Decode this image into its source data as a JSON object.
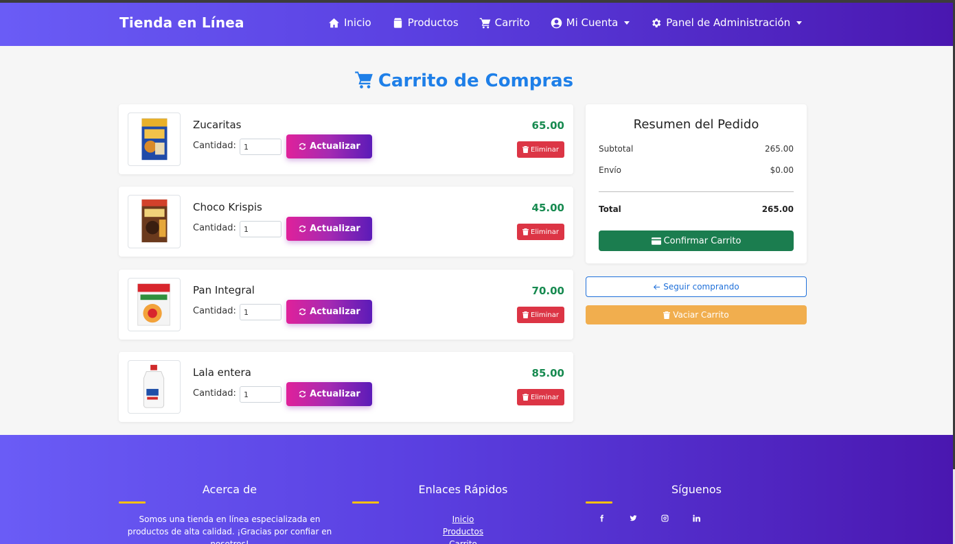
{
  "navbar": {
    "brand": "Tienda en Línea",
    "items": [
      {
        "label": "Inicio",
        "icon": "home-icon"
      },
      {
        "label": "Productos",
        "icon": "box-icon"
      },
      {
        "label": "Carrito",
        "icon": "cart-icon"
      },
      {
        "label": "Mi Cuenta",
        "icon": "user-circle-icon",
        "dropdown": true
      },
      {
        "label": "Panel de Administración",
        "icon": "gear-icon",
        "dropdown": true
      }
    ]
  },
  "page": {
    "title": "Carrito de Compras"
  },
  "cart": {
    "quantity_label": "Cantidad:",
    "update_label": "Actualizar",
    "delete_label": "Eliminar",
    "items": [
      {
        "name": "Zucaritas",
        "quantity": "1",
        "price": "65.00"
      },
      {
        "name": "Choco Krispis",
        "quantity": "1",
        "price": "45.00"
      },
      {
        "name": "Pan Integral",
        "quantity": "1",
        "price": "70.00"
      },
      {
        "name": "Lala entera",
        "quantity": "1",
        "price": "85.00"
      }
    ]
  },
  "summary": {
    "title": "Resumen del Pedido",
    "subtotal_label": "Subtotal",
    "subtotal_value": "265.00",
    "shipping_label": "Envío",
    "shipping_value": "$0.00",
    "total_label": "Total",
    "total_value": "265.00",
    "confirm_label": "Confirmar Carrito",
    "continue_label": "Seguir comprando",
    "empty_label": "Vaciar Carrito"
  },
  "footer": {
    "about_title": "Acerca de",
    "about_text": "Somos una tienda en línea especializada en productos de alta calidad. ¡Gracias por confiar en nosotros!",
    "links_title": "Enlaces Rápidos",
    "links": [
      "Inicio",
      "Productos",
      "Carrito"
    ],
    "social_title": "Síguenos",
    "social_icons": [
      "facebook-icon",
      "twitter-icon",
      "instagram-icon",
      "linkedin-icon"
    ]
  },
  "colors": {
    "primary_gradient_start": "#6a5cf6",
    "primary_gradient_end": "#4a17b0",
    "title_blue": "#1e7fe8",
    "price_green": "#178a50",
    "danger": "#dc3545",
    "confirm_green": "#1b7d4f",
    "warning": "#f1ae4e",
    "accent_yellow": "#ffc107"
  }
}
